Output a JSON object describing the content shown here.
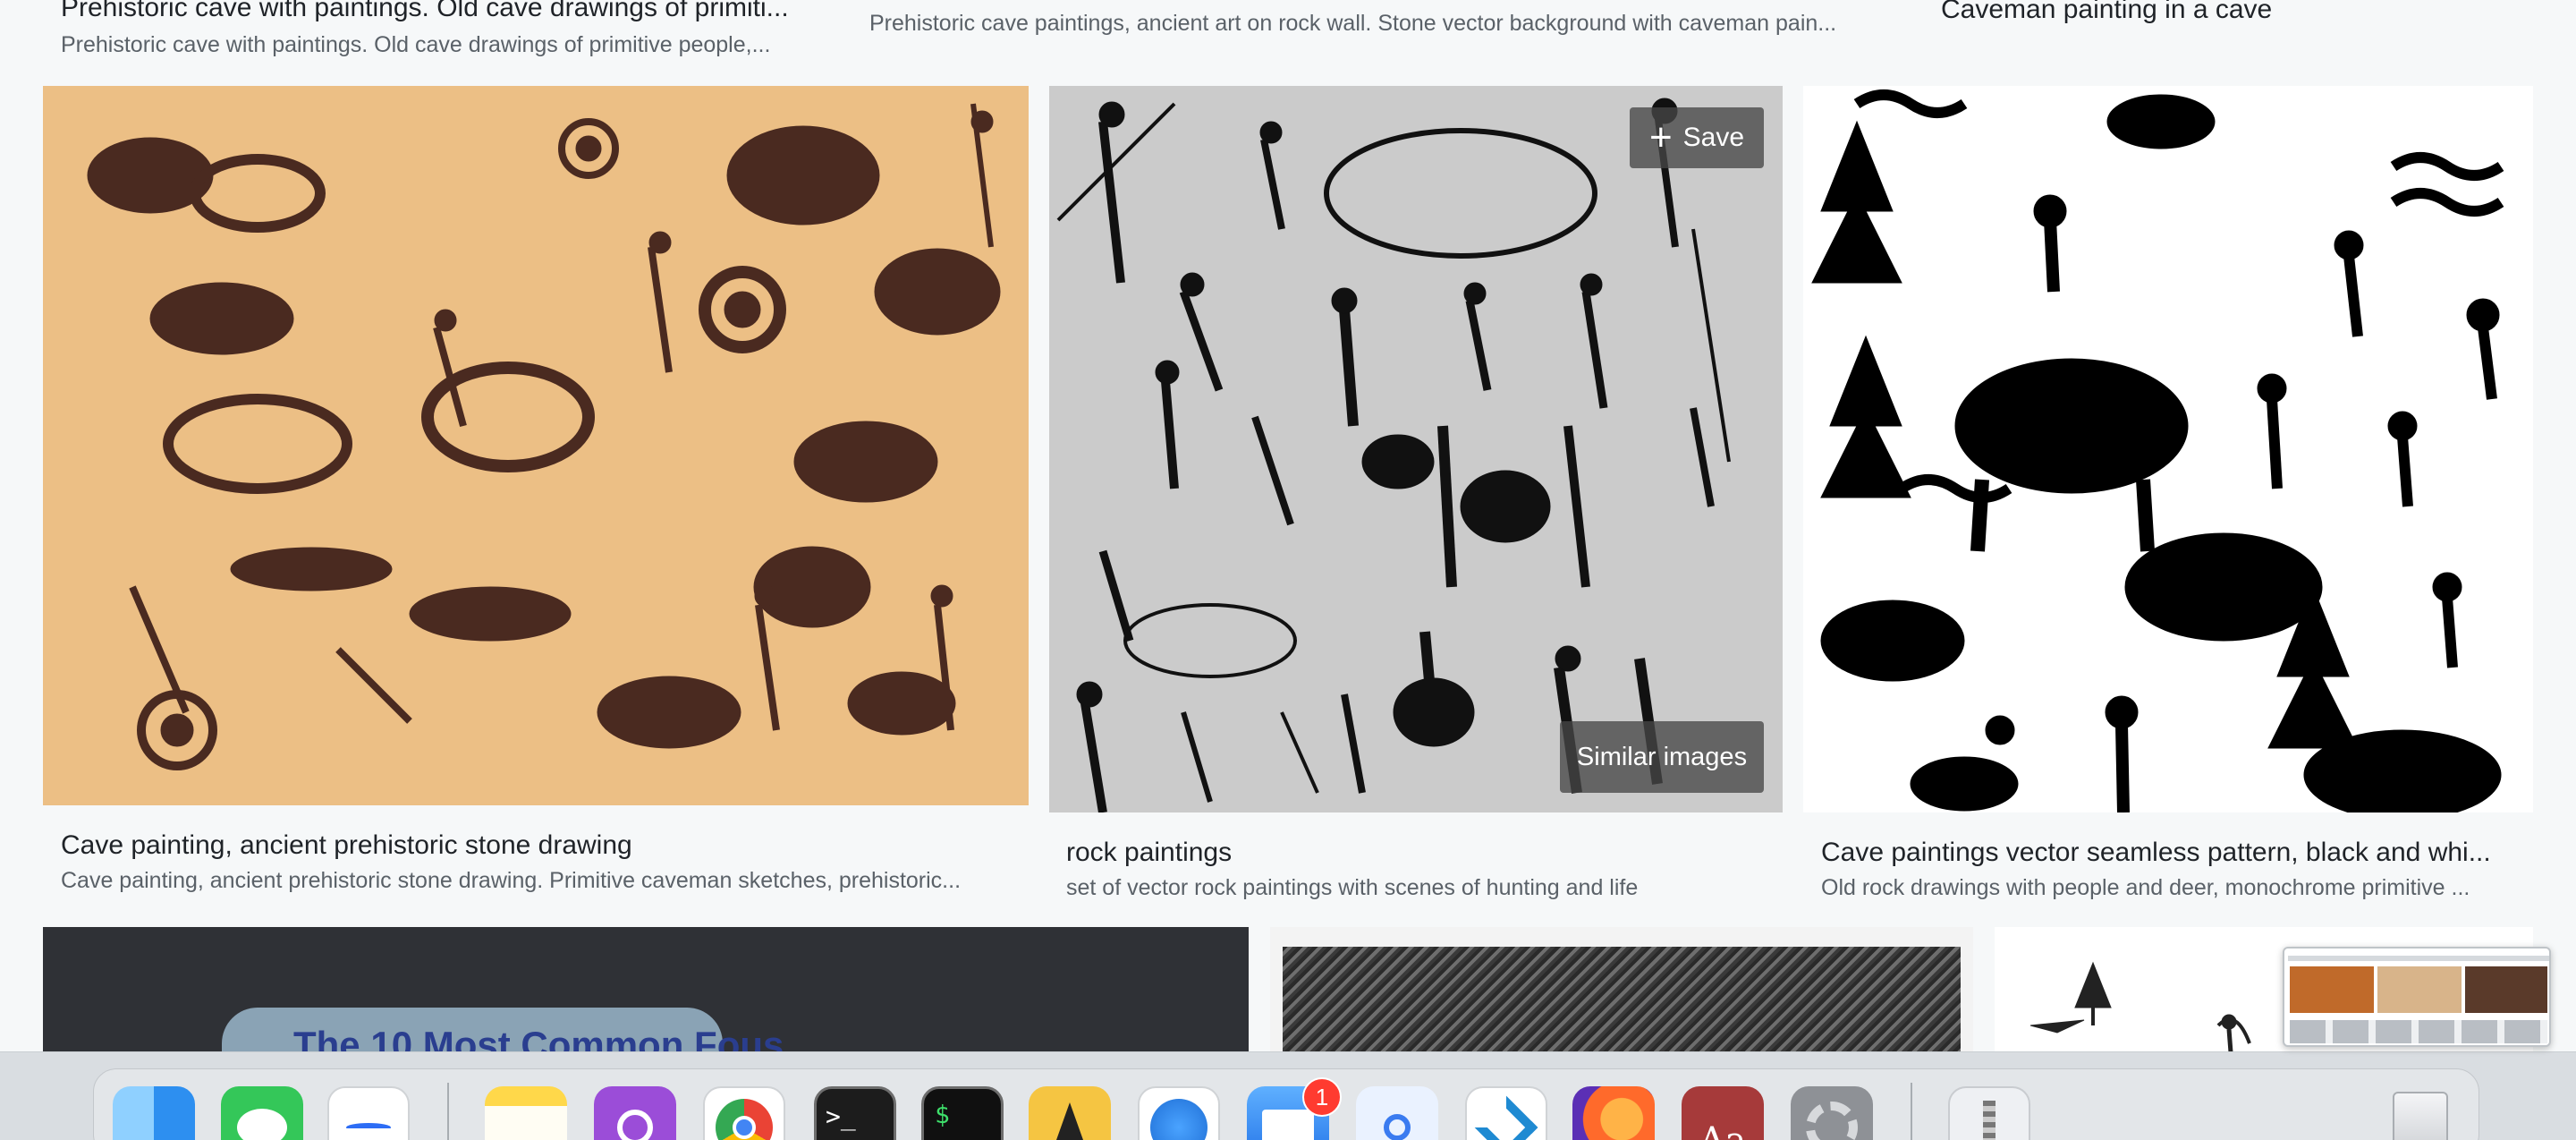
{
  "results": {
    "top_row": [
      {
        "title": "Prehistoric cave with paintings. Old cave drawings of primiti...",
        "desc": "Prehistoric cave with paintings. Old cave drawings of primitive people,..."
      },
      {
        "title": "",
        "desc": "Prehistoric cave paintings, ancient art on rock wall. Stone vector background with caveman pain..."
      },
      {
        "title": "Caveman painting in a cave",
        "desc": ""
      }
    ],
    "main_row": [
      {
        "title": "Cave painting, ancient prehistoric stone drawing",
        "desc": "Cave painting, ancient prehistoric stone drawing. Primitive caveman sketches, prehistoric..."
      },
      {
        "title": "rock paintings",
        "desc": "set of vector rock paintings with scenes of hunting and life"
      },
      {
        "title": "Cave paintings vector seamless pattern, black and whi...",
        "desc": "Old rock drawings with people and deer, monochrome primitive ..."
      }
    ],
    "bottom_row": {
      "partial_title": "The 10 Most Common Fous"
    },
    "overlay": {
      "save_label": "Save",
      "similar_label": "Similar images"
    }
  },
  "dock": {
    "items": [
      {
        "name": "Finder",
        "icon": "finder-icon",
        "color": "#2d8ff0"
      },
      {
        "name": "Messages",
        "icon": "messages-icon",
        "color": "#34c759"
      },
      {
        "name": "Freeform",
        "icon": "freeform-icon",
        "color": "#ffffff"
      },
      {
        "name": "Notes",
        "icon": "notes-icon",
        "color": "#ffd84a"
      },
      {
        "name": "Podcasts",
        "icon": "podcasts-icon",
        "color": "#9b4dd8"
      },
      {
        "name": "Chrome",
        "icon": "chrome-icon",
        "color": "#ffffff"
      },
      {
        "name": "Terminal",
        "icon": "terminal-icon",
        "color": "#1c1c1c"
      },
      {
        "name": "iTerm",
        "icon": "iterm-icon",
        "color": "#101010"
      },
      {
        "name": "Vectorworks",
        "icon": "pen-icon",
        "color": "#f5c542"
      },
      {
        "name": "Safari",
        "icon": "safari-icon",
        "color": "#ffffff"
      },
      {
        "name": "Mail",
        "icon": "mail-icon",
        "color": "#3a8ef6"
      },
      {
        "name": "Passwords",
        "icon": "key-icon",
        "color": "#eaf2ff"
      },
      {
        "name": "VS Code",
        "icon": "vscode-icon",
        "color": "#ffffff"
      },
      {
        "name": "Firefox",
        "icon": "firefox-icon",
        "color": "#5b2fb5"
      },
      {
        "name": "Dictionary",
        "icon": "dictionary-icon",
        "color": "#a63a3a"
      },
      {
        "name": "System Settings",
        "icon": "settings-icon",
        "color": "#8e9196"
      },
      {
        "name": "Archive Utility",
        "icon": "zip-icon",
        "color": "#eef0f3"
      },
      {
        "name": "Trash",
        "icon": "trash-icon",
        "color": "#e7e9ec"
      }
    ],
    "mail_badge": "1",
    "terminal_glyph": ">_",
    "iterm_glyph": "$",
    "dictionary_glyph": "Aa"
  }
}
